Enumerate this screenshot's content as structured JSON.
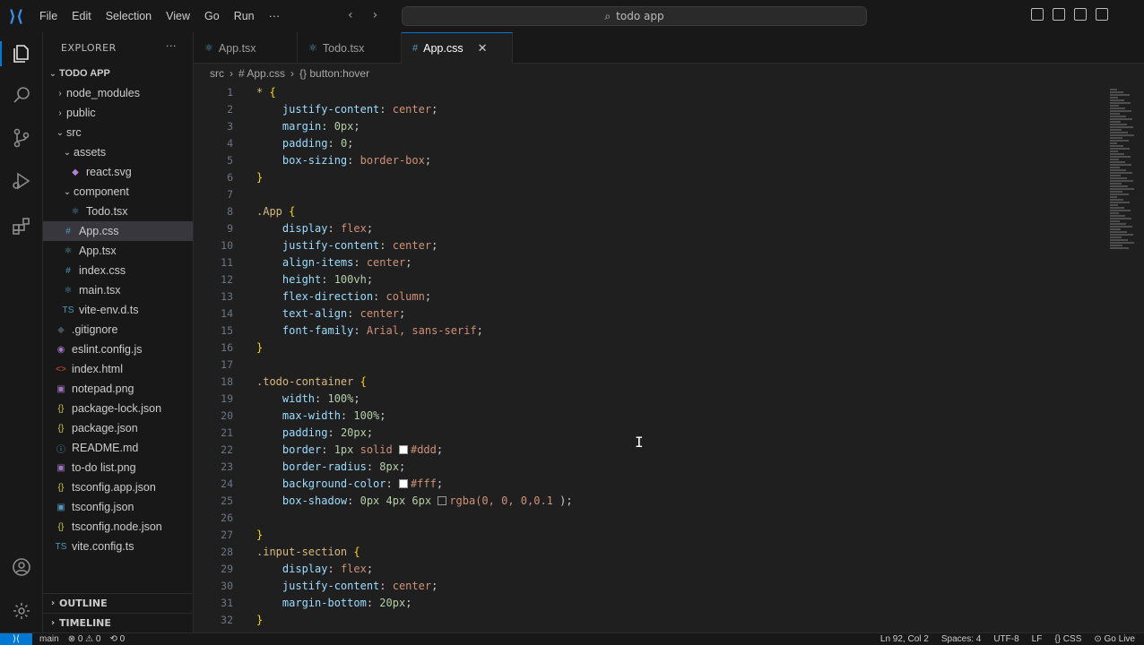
{
  "titlebar": {
    "menu": [
      "File",
      "Edit",
      "Selection",
      "View",
      "Go",
      "Run",
      "···"
    ],
    "search_text": "todo app"
  },
  "sidebar": {
    "title": "EXPLORER",
    "more": "···",
    "root": "TODO APP",
    "items": [
      {
        "label": "node_modules",
        "depth": 1,
        "kind": "folder",
        "open": false,
        "icon": ""
      },
      {
        "label": "public",
        "depth": 1,
        "kind": "folder",
        "open": false,
        "icon": ""
      },
      {
        "label": "src",
        "depth": 1,
        "kind": "folder",
        "open": true,
        "icon": ""
      },
      {
        "label": "assets",
        "depth": 2,
        "kind": "folder",
        "open": true,
        "icon": ""
      },
      {
        "label": "react.svg",
        "depth": 3,
        "kind": "file",
        "icon": "svg-icon",
        "color": "#b180d7"
      },
      {
        "label": "component",
        "depth": 2,
        "kind": "folder",
        "open": true,
        "icon": ""
      },
      {
        "label": "Todo.tsx",
        "depth": 3,
        "kind": "file",
        "icon": "react-icon",
        "color": "#519aba"
      },
      {
        "label": "App.css",
        "depth": 2,
        "kind": "file",
        "icon": "css-hash-icon",
        "color": "#519aba",
        "selected": true
      },
      {
        "label": "App.tsx",
        "depth": 2,
        "kind": "file",
        "icon": "react-icon",
        "color": "#519aba"
      },
      {
        "label": "index.css",
        "depth": 2,
        "kind": "file",
        "icon": "css-hash-icon",
        "color": "#519aba"
      },
      {
        "label": "main.tsx",
        "depth": 2,
        "kind": "file",
        "icon": "react-icon",
        "color": "#519aba"
      },
      {
        "label": "vite-env.d.ts",
        "depth": 2,
        "kind": "file",
        "icon": "ts-icon",
        "color": "#519aba"
      },
      {
        "label": ".gitignore",
        "depth": 1,
        "kind": "file",
        "icon": "git-icon",
        "color": "#41535b"
      },
      {
        "label": "eslint.config.js",
        "depth": 1,
        "kind": "file",
        "icon": "eslint-icon",
        "color": "#a074c4"
      },
      {
        "label": "index.html",
        "depth": 1,
        "kind": "file",
        "icon": "html-icon",
        "color": "#e44d26"
      },
      {
        "label": "notepad.png",
        "depth": 1,
        "kind": "file",
        "icon": "image-icon",
        "color": "#a074c4"
      },
      {
        "label": "package-lock.json",
        "depth": 1,
        "kind": "file",
        "icon": "json-icon",
        "color": "#cbcb41"
      },
      {
        "label": "package.json",
        "depth": 1,
        "kind": "file",
        "icon": "json-icon",
        "color": "#cbcb41"
      },
      {
        "label": "README.md",
        "depth": 1,
        "kind": "file",
        "icon": "info-icon",
        "color": "#519aba"
      },
      {
        "label": "to-do list.png",
        "depth": 1,
        "kind": "file",
        "icon": "image-icon",
        "color": "#a074c4"
      },
      {
        "label": "tsconfig.app.json",
        "depth": 1,
        "kind": "file",
        "icon": "json-icon",
        "color": "#cbcb41"
      },
      {
        "label": "tsconfig.json",
        "depth": 1,
        "kind": "file",
        "icon": "tsconfig-icon",
        "color": "#519aba"
      },
      {
        "label": "tsconfig.node.json",
        "depth": 1,
        "kind": "file",
        "icon": "json-icon",
        "color": "#cbcb41"
      },
      {
        "label": "vite.config.ts",
        "depth": 1,
        "kind": "file",
        "icon": "ts-icon",
        "color": "#519aba"
      }
    ],
    "outline": "OUTLINE",
    "timeline": "TIMELINE"
  },
  "tabs": [
    {
      "label": "App.tsx",
      "icon": "⚛",
      "active": false
    },
    {
      "label": "Todo.tsx",
      "icon": "⚛",
      "active": false
    },
    {
      "label": "App.css",
      "icon": "#",
      "active": true
    }
  ],
  "breadcrumb": [
    "src",
    "#  App.css",
    "{} button:hover"
  ],
  "code_lines": [
    {
      "n": "1",
      "t": [
        [
          "sel",
          "* "
        ],
        [
          "brace",
          "{"
        ]
      ]
    },
    {
      "n": "2",
      "t": [
        [
          "prop",
          "    justify-content"
        ],
        [
          "punc",
          ": "
        ],
        [
          "val",
          "center"
        ],
        [
          "punc",
          ";"
        ]
      ]
    },
    {
      "n": "3",
      "t": [
        [
          "prop",
          "    margin"
        ],
        [
          "punc",
          ": "
        ],
        [
          "num",
          "0px"
        ],
        [
          "punc",
          ";"
        ]
      ]
    },
    {
      "n": "4",
      "t": [
        [
          "prop",
          "    padding"
        ],
        [
          "punc",
          ": "
        ],
        [
          "num",
          "0"
        ],
        [
          "punc",
          ";"
        ]
      ]
    },
    {
      "n": "5",
      "t": [
        [
          "prop",
          "    box-sizing"
        ],
        [
          "punc",
          ": "
        ],
        [
          "val",
          "border-box"
        ],
        [
          "punc",
          ";"
        ]
      ]
    },
    {
      "n": "6",
      "t": [
        [
          "brace",
          "}"
        ]
      ]
    },
    {
      "n": "7",
      "t": []
    },
    {
      "n": "8",
      "t": [
        [
          "sel",
          ".App "
        ],
        [
          "brace",
          "{"
        ]
      ]
    },
    {
      "n": "9",
      "t": [
        [
          "prop",
          "    display"
        ],
        [
          "punc",
          ": "
        ],
        [
          "val",
          "flex"
        ],
        [
          "punc",
          ";"
        ]
      ]
    },
    {
      "n": "10",
      "t": [
        [
          "prop",
          "    justify-content"
        ],
        [
          "punc",
          ": "
        ],
        [
          "val",
          "center"
        ],
        [
          "punc",
          ";"
        ]
      ]
    },
    {
      "n": "11",
      "t": [
        [
          "prop",
          "    align-items"
        ],
        [
          "punc",
          ": "
        ],
        [
          "val",
          "center"
        ],
        [
          "punc",
          ";"
        ]
      ]
    },
    {
      "n": "12",
      "t": [
        [
          "prop",
          "    height"
        ],
        [
          "punc",
          ": "
        ],
        [
          "num",
          "100vh"
        ],
        [
          "punc",
          ";"
        ]
      ]
    },
    {
      "n": "13",
      "t": [
        [
          "prop",
          "    flex-direction"
        ],
        [
          "punc",
          ": "
        ],
        [
          "val",
          "column"
        ],
        [
          "punc",
          ";"
        ]
      ]
    },
    {
      "n": "14",
      "t": [
        [
          "prop",
          "    text-align"
        ],
        [
          "punc",
          ": "
        ],
        [
          "val",
          "center"
        ],
        [
          "punc",
          ";"
        ]
      ]
    },
    {
      "n": "15",
      "t": [
        [
          "prop",
          "    font-family"
        ],
        [
          "punc",
          ": "
        ],
        [
          "val",
          "Arial, sans-serif"
        ],
        [
          "punc",
          ";"
        ]
      ]
    },
    {
      "n": "16",
      "t": [
        [
          "brace",
          "}"
        ]
      ]
    },
    {
      "n": "17",
      "t": []
    },
    {
      "n": "18",
      "t": [
        [
          "sel",
          ".todo-container "
        ],
        [
          "brace",
          "{"
        ]
      ]
    },
    {
      "n": "19",
      "t": [
        [
          "prop",
          "    width"
        ],
        [
          "punc",
          ": "
        ],
        [
          "num",
          "100%"
        ],
        [
          "punc",
          ";"
        ]
      ]
    },
    {
      "n": "20",
      "t": [
        [
          "prop",
          "    max-width"
        ],
        [
          "punc",
          ": "
        ],
        [
          "num",
          "100%"
        ],
        [
          "punc",
          ";"
        ]
      ]
    },
    {
      "n": "21",
      "t": [
        [
          "prop",
          "    padding"
        ],
        [
          "punc",
          ": "
        ],
        [
          "num",
          "20px"
        ],
        [
          "punc",
          ";"
        ]
      ]
    },
    {
      "n": "22",
      "t": [
        [
          "prop",
          "    border"
        ],
        [
          "punc",
          ": "
        ],
        [
          "num",
          "1px "
        ],
        [
          "val",
          "solid "
        ],
        [
          "swatch",
          ""
        ],
        [
          "val",
          "#ddd"
        ],
        [
          "punc",
          ";"
        ]
      ]
    },
    {
      "n": "23",
      "t": [
        [
          "prop",
          "    border-radius"
        ],
        [
          "punc",
          ": "
        ],
        [
          "num",
          "8px"
        ],
        [
          "punc",
          ";"
        ]
      ]
    },
    {
      "n": "24",
      "t": [
        [
          "prop",
          "    background-color"
        ],
        [
          "punc",
          ": "
        ],
        [
          "swatch",
          ""
        ],
        [
          "val",
          "#fff"
        ],
        [
          "punc",
          ";"
        ]
      ]
    },
    {
      "n": "25",
      "t": [
        [
          "prop",
          "    box-shadow"
        ],
        [
          "punc",
          ": "
        ],
        [
          "num",
          "0px 4px 6px "
        ],
        [
          "swatchd",
          ""
        ],
        [
          "val",
          "rgba(0, 0, 0,0.1 "
        ],
        [
          "punc",
          ");"
        ]
      ]
    },
    {
      "n": "26",
      "t": []
    },
    {
      "n": "27",
      "t": [
        [
          "brace",
          "}"
        ]
      ]
    },
    {
      "n": "28",
      "t": [
        [
          "sel",
          ".input-section "
        ],
        [
          "brace",
          "{"
        ]
      ]
    },
    {
      "n": "29",
      "t": [
        [
          "prop",
          "    display"
        ],
        [
          "punc",
          ": "
        ],
        [
          "val",
          "flex"
        ],
        [
          "punc",
          ";"
        ]
      ]
    },
    {
      "n": "30",
      "t": [
        [
          "prop",
          "    justify-content"
        ],
        [
          "punc",
          ": "
        ],
        [
          "val",
          "center"
        ],
        [
          "punc",
          ";"
        ]
      ]
    },
    {
      "n": "31",
      "t": [
        [
          "prop",
          "    margin-bottom"
        ],
        [
          "punc",
          ": "
        ],
        [
          "num",
          "20px"
        ],
        [
          "punc",
          ";"
        ]
      ]
    },
    {
      "n": "32",
      "t": [
        [
          "brace",
          "}"
        ]
      ]
    }
  ],
  "statusbar": {
    "left": [
      "main",
      "⊗ 0 ⚠ 0",
      "⟲ 0"
    ],
    "right": [
      "Ln 92, Col 2",
      "Spaces: 4",
      "UTF-8",
      "LF",
      "{} CSS",
      "⊙ Go Live"
    ]
  },
  "colors": {
    "accent": "#0078d4",
    "background": "#1f1f1f",
    "chrome": "#181818"
  }
}
